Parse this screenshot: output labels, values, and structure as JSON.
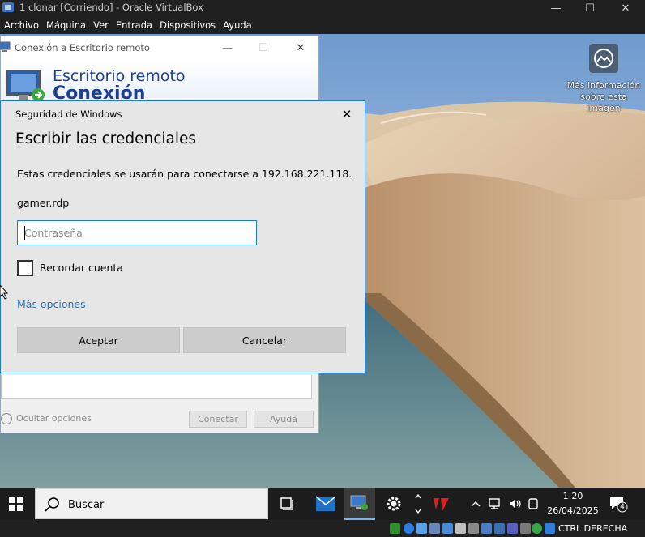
{
  "vbox": {
    "title": "1 clonar [Corriendo] - Oracle VirtualBox",
    "menu": [
      "Archivo",
      "Máquina",
      "Ver",
      "Entrada",
      "Dispositivos",
      "Ayuda"
    ],
    "controls": {
      "minimize": "—",
      "maximize": "☐",
      "close": "✕"
    },
    "status": {
      "host_key": "CTRL DERECHA"
    }
  },
  "desktop": {
    "info": {
      "line1": "Más información",
      "line2": "sobre esta imagen"
    }
  },
  "rdc": {
    "title": "Conexión a Escritorio remoto",
    "heading1": "Escritorio remoto",
    "heading2": "Conexión",
    "options_toggle": "Ocultar opciones",
    "connect": "Conectar",
    "help": "Ayuda",
    "controls": {
      "minimize": "—",
      "maximize": "☐",
      "close": "✕"
    }
  },
  "credential": {
    "window_title": "Seguridad de Windows",
    "close": "✕",
    "heading": "Escribir las credenciales",
    "message": "Estas credenciales se usarán para conectarse a 192.168.221.118.",
    "filename": "gamer.rdp",
    "password_placeholder": "Contraseña",
    "password_value": "",
    "remember": "Recordar cuenta",
    "remember_checked": false,
    "more_options": "Más opciones",
    "ok": "Aceptar",
    "cancel": "Cancelar"
  },
  "taskbar": {
    "search_placeholder": "Buscar",
    "clock_time": "1:20",
    "clock_date": "26/04/2025",
    "notification_count": "4"
  },
  "colors": {
    "accent": "#1b7bd2",
    "link": "#1b74c5",
    "rdc_heading": "#1c3f94",
    "taskbar": "#1c1c1c"
  }
}
